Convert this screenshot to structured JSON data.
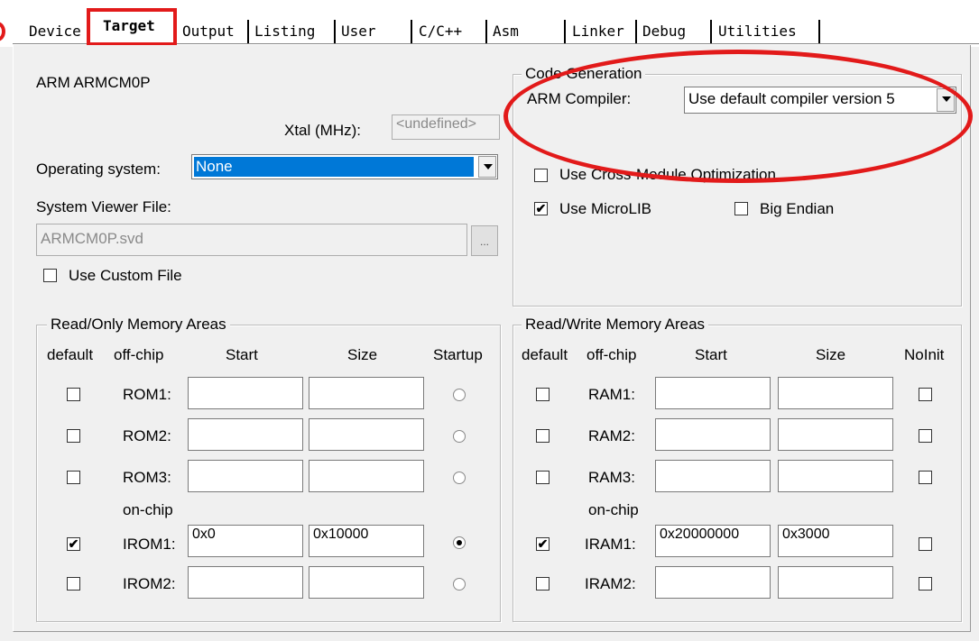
{
  "tabs": [
    "Device",
    "Target",
    "Output",
    "Listing",
    "User",
    "C/C++",
    "Asm",
    "Linker",
    "Debug",
    "Utilities"
  ],
  "selected_tab": "Target",
  "device_name": "ARM ARMCM0P",
  "xtal": {
    "label": "Xtal (MHz):",
    "value": "<undefined>"
  },
  "os": {
    "label": "Operating system:",
    "value": "None"
  },
  "svf": {
    "label": "System Viewer File:",
    "value": "ARMCM0P.svd",
    "browse": "..."
  },
  "use_custom_file": {
    "label": "Use Custom File",
    "checked": false
  },
  "code_gen": {
    "title": "Code Generation",
    "compiler_label": "ARM Compiler:",
    "compiler_value": "Use default compiler version 5",
    "cross_module": {
      "label": "Use Cross-Module Optimization",
      "checked": false
    },
    "microlib": {
      "label": "Use MicroLIB",
      "checked": true
    },
    "big_endian": {
      "label": "Big Endian",
      "checked": false
    }
  },
  "ro": {
    "title": "Read/Only Memory Areas",
    "headers": {
      "default": "default",
      "offchip": "off-chip",
      "start": "Start",
      "size": "Size",
      "last": "Startup"
    },
    "onchip_label": "on-chip",
    "rows": [
      {
        "name": "ROM1:",
        "default": false,
        "start": "",
        "size": "",
        "flag": false
      },
      {
        "name": "ROM2:",
        "default": false,
        "start": "",
        "size": "",
        "flag": false
      },
      {
        "name": "ROM3:",
        "default": false,
        "start": "",
        "size": "",
        "flag": false
      },
      {
        "name": "IROM1:",
        "default": true,
        "start": "0x0",
        "size": "0x10000",
        "flag": true
      },
      {
        "name": "IROM2:",
        "default": false,
        "start": "",
        "size": "",
        "flag": false
      }
    ]
  },
  "rw": {
    "title": "Read/Write Memory Areas",
    "headers": {
      "default": "default",
      "offchip": "off-chip",
      "start": "Start",
      "size": "Size",
      "last": "NoInit"
    },
    "onchip_label": "on-chip",
    "rows": [
      {
        "name": "RAM1:",
        "default": false,
        "start": "",
        "size": "",
        "flag": false
      },
      {
        "name": "RAM2:",
        "default": false,
        "start": "",
        "size": "",
        "flag": false
      },
      {
        "name": "RAM3:",
        "default": false,
        "start": "",
        "size": "",
        "flag": false
      },
      {
        "name": "IRAM1:",
        "default": true,
        "start": "0x20000000",
        "size": "0x3000",
        "flag": false
      },
      {
        "name": "IRAM2:",
        "default": false,
        "start": "",
        "size": "",
        "flag": false
      }
    ]
  },
  "colors": {
    "highlight": "#e21a1a",
    "selection": "#0078d7"
  }
}
